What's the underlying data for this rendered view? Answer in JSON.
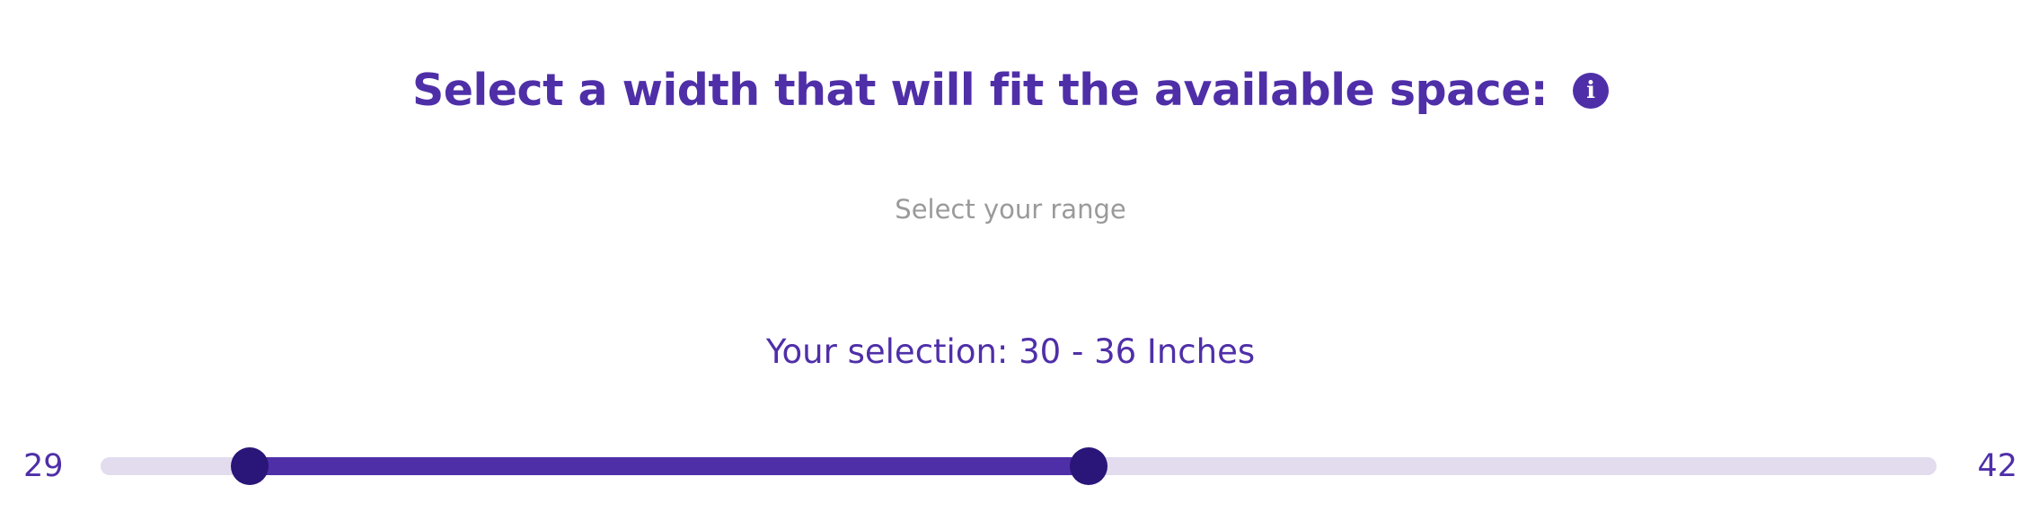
{
  "header": {
    "title": "Select a width that will fit the available space:",
    "info_icon": "info-icon",
    "info_glyph": "i"
  },
  "subtitle": "Select your range",
  "selection": {
    "text": "Your selection: 30 - 36 Inches",
    "low": 30,
    "high": 36
  },
  "slider": {
    "min_label": "29",
    "max_label": "42",
    "min": 29,
    "max": 42
  },
  "colors": {
    "accent": "#4f2fa8",
    "thumb": "#2a1578",
    "track": "#e2dcee",
    "subtitle": "#9a9a9a"
  }
}
